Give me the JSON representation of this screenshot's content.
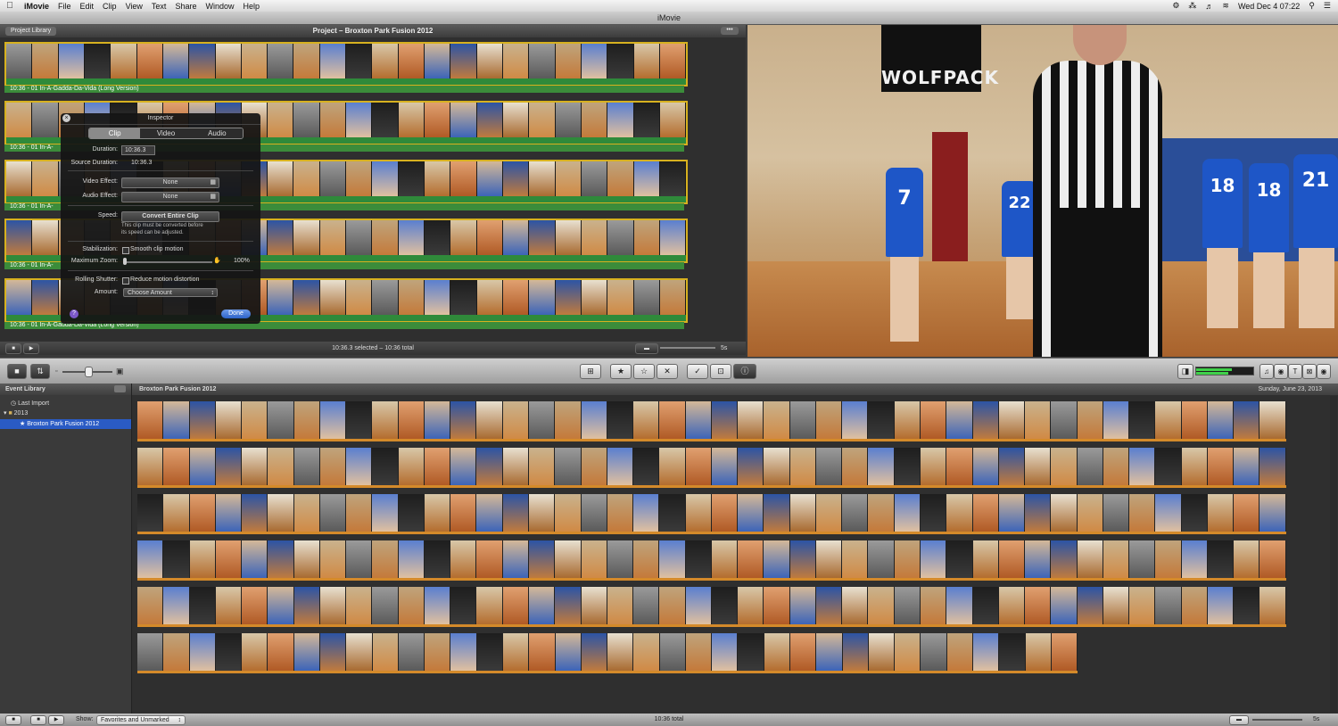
{
  "menubar": {
    "app": "iMovie",
    "items": [
      "File",
      "Edit",
      "Clip",
      "View",
      "Text",
      "Share",
      "Window",
      "Help"
    ],
    "clock": "Wed Dec 4  07:22"
  },
  "window": {
    "title": "iMovie"
  },
  "project": {
    "library_button": "Project Library",
    "title": "Project – Broxton Park Fusion 2012",
    "music_track": "10:36 - 01 In-A-Gadda-Da-Vida (Long Version)",
    "music_short": "10:36 - 01 In-A-",
    "status": "10:36.3 selected – 10:36 total",
    "zoom": "5s"
  },
  "inspector": {
    "title": "Inspector",
    "tabs": [
      "Clip",
      "Video",
      "Audio"
    ],
    "duration_label": "Duration:",
    "duration_value": "10:36.3",
    "source_duration_label": "Source Duration:",
    "source_duration_value": "10:36.3",
    "video_effect_label": "Video Effect:",
    "video_effect_value": "None",
    "audio_effect_label": "Audio Effect:",
    "audio_effect_value": "None",
    "speed_label": "Speed:",
    "convert_button": "Convert Entire Clip",
    "speed_note_1": "This clip must be converted before",
    "speed_note_2": "its speed can be adjusted.",
    "stabilization_label": "Stabilization:",
    "stabilization_option": "Smooth clip motion",
    "max_zoom_label": "Maximum Zoom:",
    "max_zoom_value": "100%",
    "rolling_label": "Rolling Shutter:",
    "rolling_option": "Reduce motion distortion",
    "amount_label": "Amount:",
    "amount_value": "Choose Amount",
    "done_button": "Done"
  },
  "viewer": {
    "banner": "WOLFPACK",
    "jerseys": [
      "7",
      "22",
      "18",
      "18",
      "21"
    ]
  },
  "event_library": {
    "title": "Event Library",
    "items": [
      "Last Import",
      "2013",
      "Broxton Park Fusion 2012"
    ]
  },
  "event_browser": {
    "title": "Broxton Park Fusion 2012",
    "date": "Sunday, June 23, 2013"
  },
  "bottombar": {
    "show_label": "Show:",
    "show_value": "Favorites and Unmarked",
    "total": "10:36 total",
    "zoom": "5s"
  },
  "colors": {
    "selection": "#d7b11f",
    "audio": "#2f8a3a",
    "event_rule": "#d48a2a",
    "accent": "#2a5bc4"
  }
}
